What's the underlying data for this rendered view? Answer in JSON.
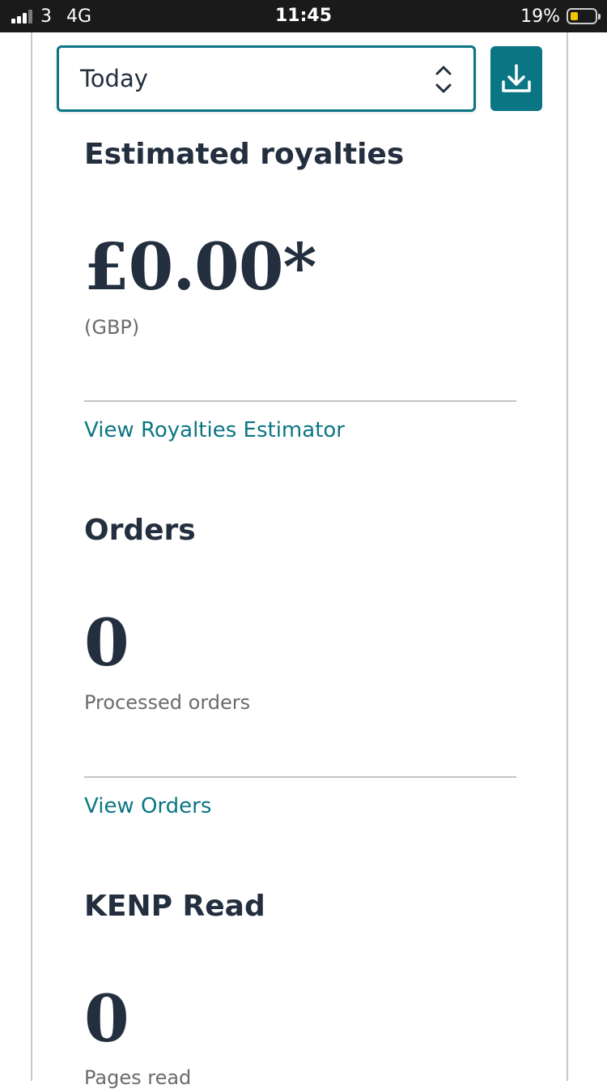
{
  "status_bar": {
    "carrier": "3",
    "network": "4G",
    "time": "11:45",
    "battery_percent": "19%",
    "signal_bars": 3,
    "battery_level": 0.19
  },
  "range_select": {
    "value": "Today",
    "icon": "chevron-up-down-icon"
  },
  "download_button": {
    "icon": "download-icon"
  },
  "royalties": {
    "title": "Estimated royalties",
    "amount": "£0.00*",
    "currency": "(GBP)",
    "link": "View Royalties Estimator"
  },
  "orders": {
    "title": "Orders",
    "count": "0",
    "label": "Processed orders",
    "link": "View Orders"
  },
  "kenp": {
    "title": "KENP Read",
    "count": "0",
    "label": "Pages read"
  },
  "colors": {
    "accent": "#0b7683",
    "heading": "#232f3e",
    "muted": "#6b6b6b",
    "battery_low": "#f5c400"
  }
}
